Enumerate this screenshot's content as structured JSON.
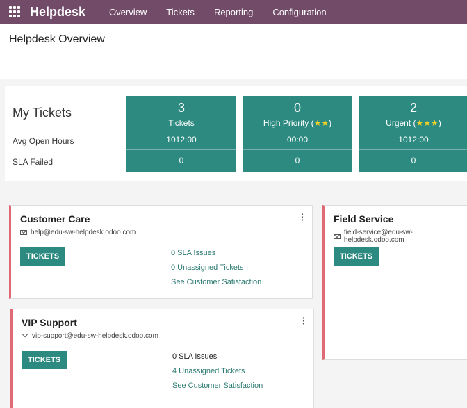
{
  "nav": {
    "brand": "Helpdesk",
    "items": [
      "Overview",
      "Tickets",
      "Reporting",
      "Configuration"
    ]
  },
  "page": {
    "title": "Helpdesk Overview"
  },
  "my_tickets": {
    "title": "My Tickets",
    "row_labels": [
      "Avg Open Hours",
      "SLA Failed"
    ],
    "tiles": [
      {
        "count": "3",
        "label": "Tickets",
        "stars": "",
        "avg_open_hours": "1012:00",
        "sla_failed": "0"
      },
      {
        "count": "0",
        "label": "High Priority (",
        "stars": "★★",
        "suffix": ")",
        "avg_open_hours": "00:00",
        "sla_failed": "0"
      },
      {
        "count": "2",
        "label": "Urgent (",
        "stars": "★★★",
        "suffix": ")",
        "avg_open_hours": "1012:00",
        "sla_failed": "0"
      }
    ]
  },
  "teams": [
    {
      "name": "Customer Care",
      "email": "help@edu-sw-helpdesk.odoo.com",
      "button": "TICKETS",
      "sla_issues": "0 SLA Issues",
      "unassigned": "0 Unassigned Tickets",
      "satisfaction": "See Customer Satisfaction"
    },
    {
      "name": "VIP Support",
      "email": "vip-support@edu-sw-helpdesk.odoo.com",
      "button": "TICKETS",
      "sla_issues": "0 SLA Issues",
      "unassigned": "4 Unassigned Tickets",
      "satisfaction": "See Customer Satisfaction"
    },
    {
      "name": "Field Service",
      "email": "field-service@edu-sw-helpdesk.odoo.com",
      "button": "TICKETS"
    }
  ],
  "colors": {
    "brand": "#714b67",
    "accent": "#2d8a80",
    "card_border": "#e06a73"
  }
}
